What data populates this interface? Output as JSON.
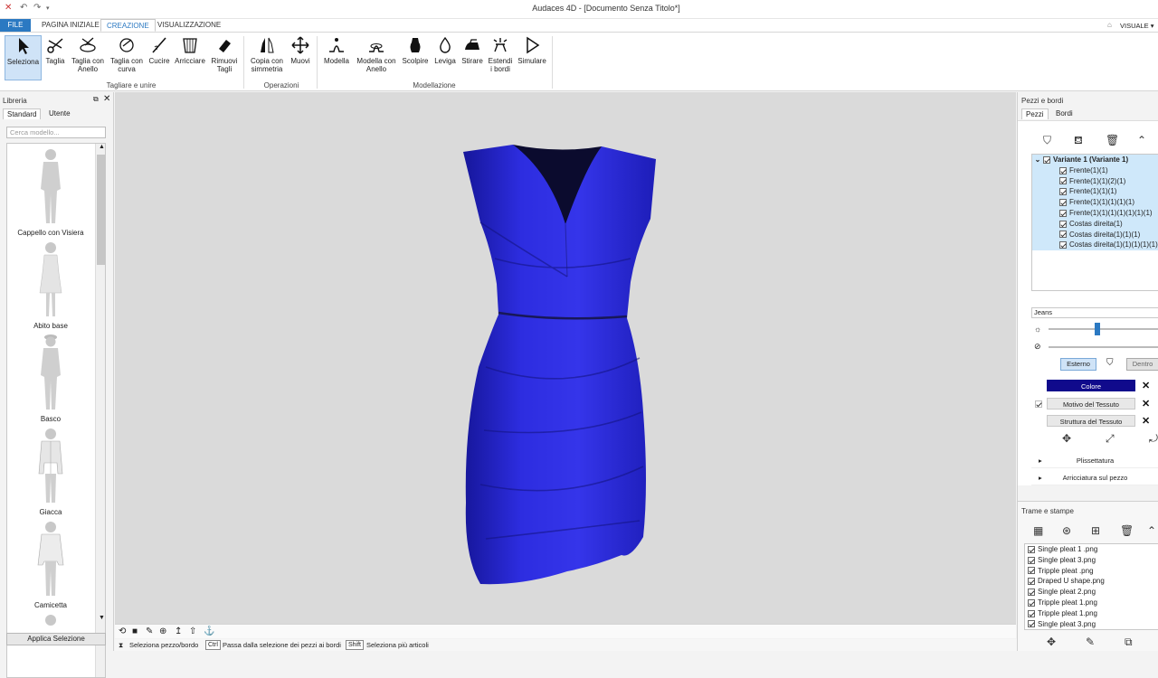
{
  "window": {
    "title": "Audaces 4D - [Documento Senza Titolo*]",
    "visual_label": "VISUALE ▾"
  },
  "tabs": [
    {
      "label": "FILE"
    },
    {
      "label": "PAGINA INIZIALE"
    },
    {
      "label": "CREAZIONE"
    },
    {
      "label": "VISUALIZZAZIONE"
    }
  ],
  "ribbon": {
    "tools": [
      {
        "label": "Seleziona",
        "icon": "cursor-icon"
      },
      {
        "label": "Taglia",
        "icon": "scissors-icon"
      },
      {
        "label": "Taglia con Anello",
        "icon": "ring-cut-icon"
      },
      {
        "label": "Taglia con curva",
        "icon": "curve-cut-icon"
      },
      {
        "label": "Cucire",
        "icon": "needle-icon"
      },
      {
        "label": "Arricciare",
        "icon": "gather-icon"
      },
      {
        "label": "Rimuovi Tagli",
        "icon": "eraser-icon"
      },
      {
        "label": "Copia con simmetria",
        "icon": "mirror-copy-icon"
      },
      {
        "label": "Muovi",
        "icon": "move-icon"
      },
      {
        "label": "Modella",
        "icon": "model-icon"
      },
      {
        "label": "Modella con Anello",
        "icon": "model-ring-icon"
      },
      {
        "label": "Scolpire",
        "icon": "sculpt-icon"
      },
      {
        "label": "Leviga",
        "icon": "drop-icon"
      },
      {
        "label": "Stirare",
        "icon": "iron-icon"
      },
      {
        "label": "Estendi i bordi",
        "icon": "extend-edges-icon"
      },
      {
        "label": "Simulare",
        "icon": "play-icon"
      }
    ],
    "groups": [
      {
        "label": "Tagliare e unire"
      },
      {
        "label": "Operazioni"
      },
      {
        "label": "Modellazione"
      }
    ]
  },
  "library": {
    "title": "Libreria",
    "tabs": [
      "Standard",
      "Utente"
    ],
    "search_placeholder": "Cerca modello...",
    "items": [
      {
        "label": "Cappello con Visiera"
      },
      {
        "label": "Abito base"
      },
      {
        "label": "Basco"
      },
      {
        "label": "Giacca"
      },
      {
        "label": "Camicetta"
      }
    ],
    "apply_label": "Applica Selezione"
  },
  "statusbar": {
    "item1": "Seleziona pezzo/bordo",
    "key2": "Ctrl",
    "item2": "Passa dalla selezione dei pezzi ai bordi",
    "key3": "Shift",
    "item3": "Seleziona più articoli"
  },
  "pieces": {
    "title": "Pezzi e bordi",
    "tabs": [
      "Pezzi",
      "Bordi"
    ],
    "root": "Variante 1 (Variante 1)",
    "items": [
      "Frente(1)(1)",
      "Frente(1)(1)(2)(1)",
      "Frente(1)(1)(1)",
      "Frente(1)(1)(1)(1)(1)",
      "Frente(1)(1)(1)(1)(1)(1)(1)",
      "Costas direita(1)",
      "Costas direita(1)(1)(1)",
      "Costas direita(1)(1)(1)(1)(1)"
    ]
  },
  "fabric": {
    "name": "Jeans",
    "slider1_value": 0.44,
    "toggle_outside": "Esterno",
    "toggle_inside": "Dentro",
    "color_label": "Colore",
    "color_hex": "#100a8c",
    "pattern_label": "Motivo del Tessuto",
    "structure_label": "Struttura del Tessuto",
    "pleating": "Plissettatura",
    "gathering": "Arricciatura sul pezzo"
  },
  "prints": {
    "title": "Trame e stampe",
    "files": [
      "Single pleat 1 .png",
      "Single pleat 3.png",
      "Tripple pleat .png",
      "Draped U shape.png",
      "Single pleat 2.png",
      "Tripple pleat 1.png",
      "Tripple pleat 1.png",
      "Single pleat 3.png"
    ]
  },
  "colors": {
    "accent": "#2b79c2",
    "dress": "#2a2ad6"
  }
}
